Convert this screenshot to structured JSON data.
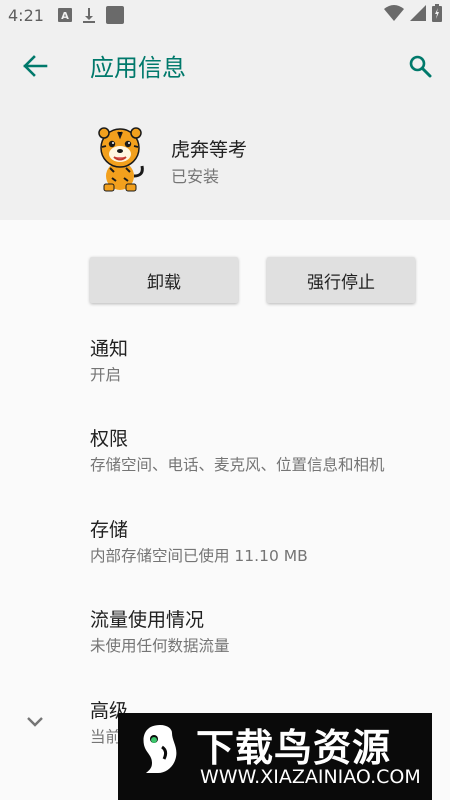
{
  "status_bar": {
    "time": "4:21",
    "icons": [
      "a-notification-icon",
      "download-icon",
      "square-app-icon"
    ],
    "right_icons": [
      "wifi-icon",
      "cell-signal-icon",
      "battery-icon"
    ]
  },
  "app_bar": {
    "title": "应用信息",
    "back_icon": "arrow-left-icon",
    "search_icon": "search-icon",
    "accent_color": "#00796b"
  },
  "app": {
    "name": "虎奔等考",
    "status": "已安装"
  },
  "actions": {
    "uninstall": "卸载",
    "force_stop": "强行停止"
  },
  "settings": {
    "items": [
      {
        "title": "通知",
        "subtitle": "开启"
      },
      {
        "title": "权限",
        "subtitle": "存储空间、电话、麦克风、位置信息和相机"
      },
      {
        "title": "存储",
        "subtitle": "内部存储空间已使用 11.10 MB"
      },
      {
        "title": "流量使用情况",
        "subtitle": "未使用任何数据流量"
      },
      {
        "title": "高级",
        "subtitle": "当前"
      }
    ]
  },
  "watermark": {
    "name": "下载鸟资源",
    "url": "WWW.XIAZAINIAO.COM"
  }
}
